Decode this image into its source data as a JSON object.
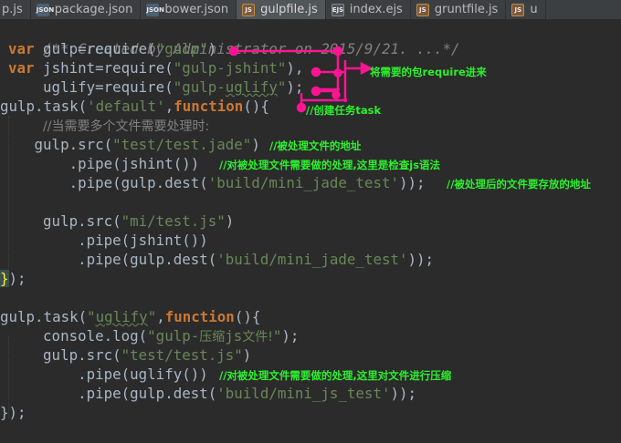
{
  "tabs": [
    {
      "label": "p.js",
      "icon": "js",
      "active": false
    },
    {
      "label": "package.json",
      "icon": "json",
      "active": false
    },
    {
      "label": "bower.json",
      "icon": "json",
      "active": false
    },
    {
      "label": "gulpfile.js",
      "icon": "js",
      "active": true
    },
    {
      "label": "index.ejs",
      "icon": "ejs",
      "active": false
    },
    {
      "label": "gruntfile.js",
      "icon": "js",
      "active": false
    },
    {
      "label": "u",
      "icon": "js",
      "active": false
    }
  ],
  "icon_text": {
    "json": "JSON",
    "js": "JS",
    "ejs": "EJS"
  },
  "code": {
    "l1": "/** Created by Administrator on 2015/9/21. ...*/",
    "var": "var",
    "l2_a": " gulp=require(",
    "l2_str": "\"gulp\"",
    "l2_b": ")",
    "l3_a": " jshint=require(",
    "l3_str": "\"gulp-jshint\"",
    "l3_b": "),",
    "l4_a": "    uglify=require(",
    "l4_str_q1": "\"gulp-",
    "l4_str_w": "uglify",
    "l4_str_q2": "\"",
    "l4_b": ");",
    "l5_a": "gulp.task(",
    "l5_str": "'default'",
    "l5_b": ",",
    "function": "function",
    "l5_c": "(){",
    "l6_indent": "    ",
    "l6_com": "//当需要多个文件需要处理时:",
    "l7_a": "   gulp.src(",
    "l7_str": "\"test/test.jade\"",
    "l7_b": ")",
    "l8_a": "       .pipe(jshint())",
    "l9_a": "       .pipe(gulp.dest(",
    "l9_str": "'build/mini_jade_test'",
    "l9_b": "));",
    "l11_a": "    gulp.src(",
    "l11_str": "\"mi/test.js\"",
    "l11_b": ")",
    "l12_a": "        .pipe(jshint())",
    "l13_a": "        .pipe(gulp.dest(",
    "l13_str": "'build/mini_jade_test'",
    "l13_b": "));",
    "close_brace": "}",
    "close_rest": ");",
    "l16_a": "gulp.task(",
    "l16_str_q1": "\"",
    "l16_str_w": "uglify",
    "l16_str_q2": "\"",
    "l16_b": ",",
    "l16_c": "(){",
    "l17_a": "    console.log(",
    "l17_str_a": "\"gulp-",
    "l17_str_cjk": "压缩",
    "l17_str_b": "js",
    "l17_str_cjk2": "文件!",
    "l17_str_c": "\"",
    "l17_b": ");",
    "l18_a": "    gulp.src(",
    "l18_str": "\"test/test.js\"",
    "l18_b": ")",
    "l19_a": "        .pipe(uglify())",
    "l20_a": "        .pipe(gulp.dest(",
    "l20_str": "'build/mini_js_test'",
    "l20_b": "));"
  },
  "notes": {
    "require": "将需要的包require进来",
    "task": "//创建任务task",
    "src_path": "//被处理文件的地址",
    "jshint": "//对被处理文件需要做的处理,这里是检查js语法",
    "dest_path": "//被处理后的文件要存放的地址",
    "uglify": "//对被处理文件需要做的处理,这里对文件进行压缩"
  },
  "colors": {
    "background": "#2b2b2b",
    "keyword": "#cc7832",
    "string": "#6a8759",
    "comment": "#808080",
    "text": "#a9b7c6",
    "note": "#2cf02c",
    "arrow": "#ff1493"
  }
}
